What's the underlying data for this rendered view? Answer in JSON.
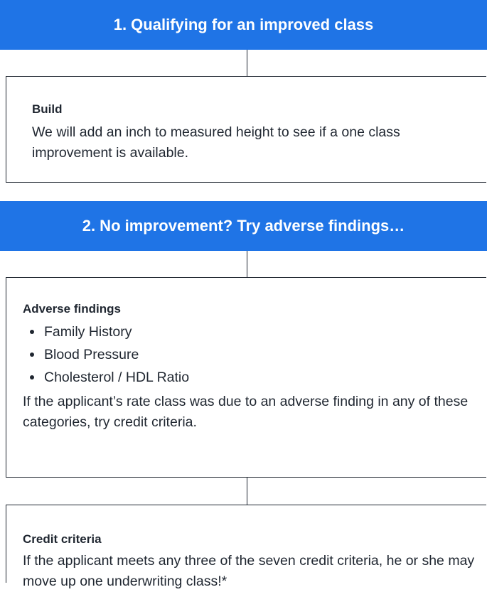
{
  "step1": {
    "banner": "1. Qualifying for an improved class",
    "box_title": "Build",
    "box_text": "We will add an inch to measured height to see if a one class improvement is available."
  },
  "step2": {
    "banner": "2. No improvement? Try adverse findings…",
    "box_title": "Adverse findings",
    "items": [
      "Family History",
      "Blood Pressure",
      "Cholesterol / HDL Ratio"
    ],
    "box_text": "If the applicant’s rate class was due to an adverse finding in any of these categories, try credit criteria."
  },
  "step3": {
    "box_title": "Credit criteria",
    "box_text": "If the applicant meets any three of the seven credit criteria, he or she may move up one underwriting class!*"
  },
  "colors": {
    "banner_bg": "#1f74e6",
    "banner_text": "#ffffff",
    "text": "#1f2630"
  }
}
